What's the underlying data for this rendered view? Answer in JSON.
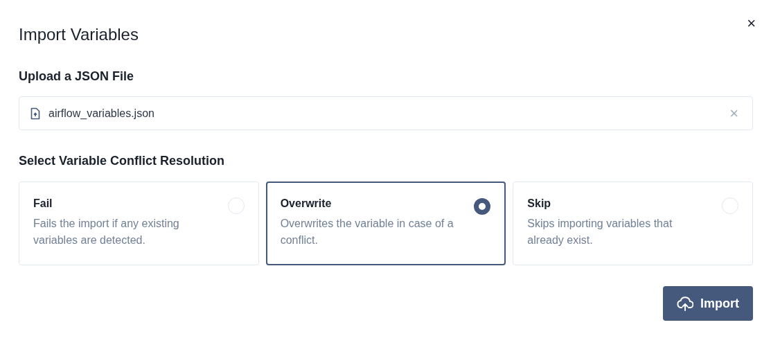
{
  "dialog": {
    "title": "Import Variables",
    "close_label": "×"
  },
  "upload": {
    "label": "Upload a JSON File",
    "file_name": "airflow_variables.json",
    "clear_label": "×"
  },
  "conflict": {
    "label": "Select Variable Conflict Resolution",
    "options": [
      {
        "title": "Fail",
        "description": "Fails the import if any existing variables are detected.",
        "selected": false
      },
      {
        "title": "Overwrite",
        "description": "Overwrites the variable in case of a conflict.",
        "selected": true
      },
      {
        "title": "Skip",
        "description": "Skips importing variables that already exist.",
        "selected": false
      }
    ]
  },
  "import_button": {
    "label": "Import"
  }
}
